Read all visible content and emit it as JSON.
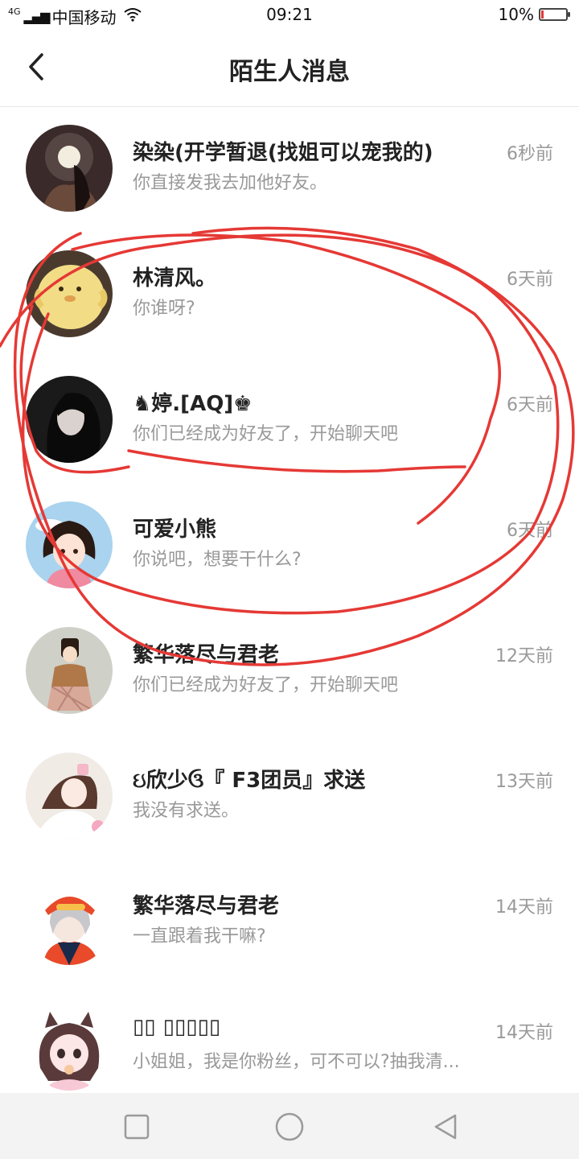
{
  "status_bar": {
    "network": "4G",
    "carrier": "中国移动",
    "time": "09:21",
    "battery": "10%",
    "battery_level": 0.1,
    "battery_color": "#e53935"
  },
  "header": {
    "title": "陌生人消息",
    "back_icon": "chevron-left-icon"
  },
  "messages": [
    {
      "name": "染染(开学暂退(找姐可以宠我的)",
      "preview": "你直接发我去加他好友。",
      "time": "6秒前"
    },
    {
      "name": "林清风。",
      "preview": "你谁呀?",
      "time": "6天前"
    },
    {
      "name": "♞婷.[AQ]♚",
      "preview": "你们已经成为好友了，开始聊天吧",
      "time": "6天前"
    },
    {
      "name": "可爱小熊",
      "preview": "你说吧，想要干什么?",
      "time": "6天前"
    },
    {
      "name": "繁华落尽与君老",
      "preview": "你们已经成为好友了，开始聊天吧",
      "time": "12天前"
    },
    {
      "name": "ઇ欣少ઉ『 F3团员』求送",
      "preview": "我没有求送。",
      "time": "13天前"
    },
    {
      "name": "繁华落尽与君老",
      "preview": "一直跟着我干嘛?",
      "time": "14天前"
    },
    {
      "name": "▯▯ ▯▯▯▯▯",
      "preview": "小姐姐，我是你粉丝，可不可以?抽我清...",
      "time": "14天前"
    }
  ],
  "nav_bar": {
    "icons": [
      "square-recents-icon",
      "circle-home-icon",
      "triangle-back-icon"
    ]
  },
  "annotation_color": "#e53935"
}
